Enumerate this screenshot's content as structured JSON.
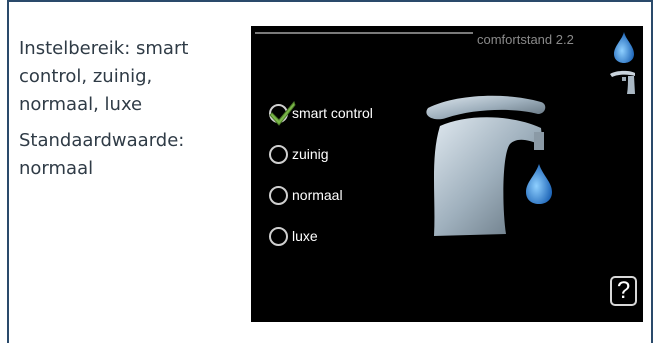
{
  "description": {
    "setting_range": "Instelbereik: smart control, zuinig, normaal, luxe",
    "default_value": "Standaardwaarde: normaal"
  },
  "screen": {
    "title": "comfortstand 2.2",
    "options": [
      {
        "label": "smart control",
        "selected": true
      },
      {
        "label": "zuinig",
        "selected": false
      },
      {
        "label": "normaal",
        "selected": false
      },
      {
        "label": "luxe",
        "selected": false
      }
    ],
    "help_label": "?",
    "icons": [
      "water-drop-icon",
      "tap-icon",
      "check-icon",
      "faucet-illustration",
      "help-icon"
    ]
  },
  "colors": {
    "screen_bg": "#000000",
    "frame": "#2a4a6b",
    "check_green": "#7ab648",
    "drop_blue": "#3a8fd9"
  }
}
